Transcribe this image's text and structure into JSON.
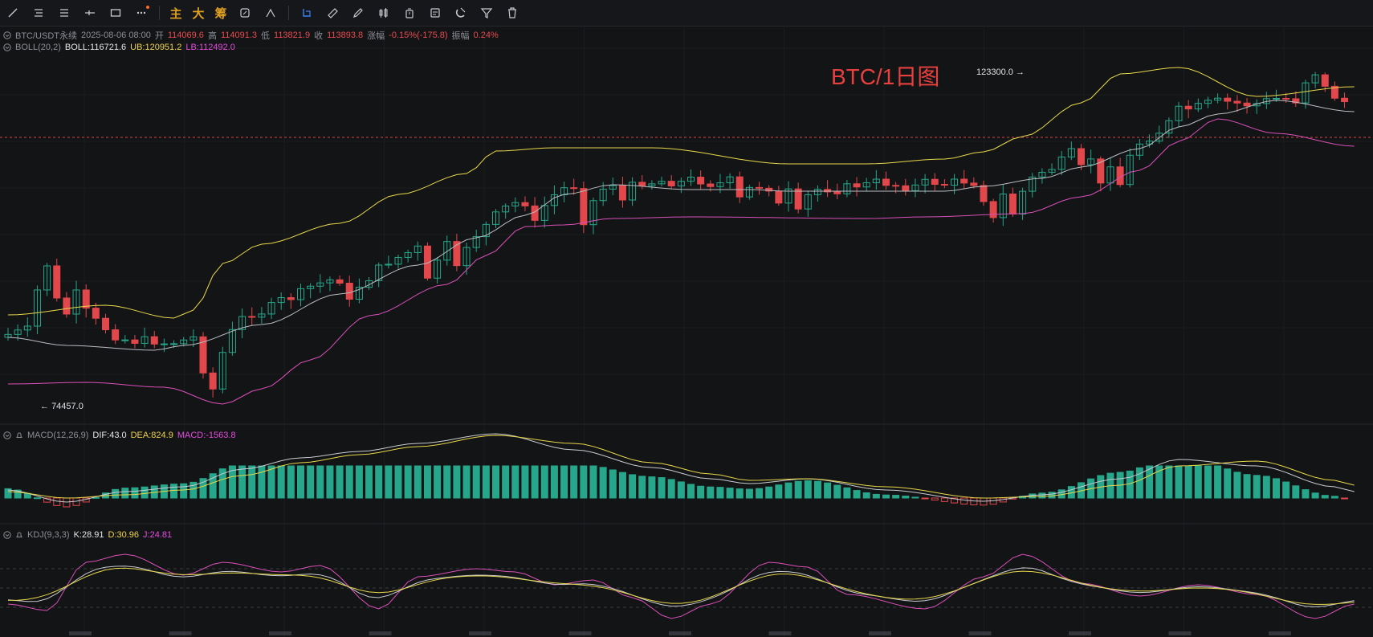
{
  "toolbar": {
    "tools": [
      {
        "name": "trend-line-icon"
      },
      {
        "name": "horizontal-lines-icon"
      },
      {
        "name": "parallel-channel-icon"
      },
      {
        "name": "horizontal-ray-icon"
      },
      {
        "name": "rectangle-icon"
      },
      {
        "name": "more-tools-icon"
      }
    ],
    "text_buttons": [
      "主",
      "大",
      "筹"
    ],
    "right_tools": [
      {
        "name": "measure-icon"
      },
      {
        "name": "ruler-icon"
      },
      {
        "name": "pencil-icon"
      },
      {
        "name": "candles-icon"
      },
      {
        "name": "timer-icon"
      },
      {
        "name": "notes-icon"
      },
      {
        "name": "magnet-icon"
      },
      {
        "name": "filter-icon"
      },
      {
        "name": "trash-icon"
      }
    ]
  },
  "legend": {
    "symbol": "BTC/USDT永续",
    "datetime": "2025-08-06 08:00",
    "open_label": "开",
    "open": "114069.6",
    "high_label": "高",
    "high": "114091.3",
    "low_label": "低",
    "low": "113821.9",
    "close_label": "收",
    "close": "113893.8",
    "change_label": "涨幅",
    "change": "-0.15%(-175.8)",
    "amp_label": "振幅",
    "amp": "0.24%"
  },
  "boll": {
    "name": "BOLL(20,2)",
    "mid": "BOLL:116721.6",
    "ub": "UB:120951.2",
    "lb": "LB:112492.0"
  },
  "macd": {
    "name": "MACD(12,26,9)",
    "dif": "DIF:43.0",
    "dea": "DEA:824.9",
    "macd": "MACD:-1563.8"
  },
  "kdj": {
    "name": "KDJ(9,3,3)",
    "k": "K:28.91",
    "d": "D:30.96",
    "j": "J:24.81"
  },
  "watermark": "BTC/1日图",
  "high_marker": "123300.0",
  "low_marker": "74457.0",
  "colors": {
    "up": "#26a68a",
    "down": "#e2474b",
    "mid": "#b9bcc2",
    "ub": "#e8d84a",
    "lb": "#d94fb8",
    "bg": "#131416"
  }
}
